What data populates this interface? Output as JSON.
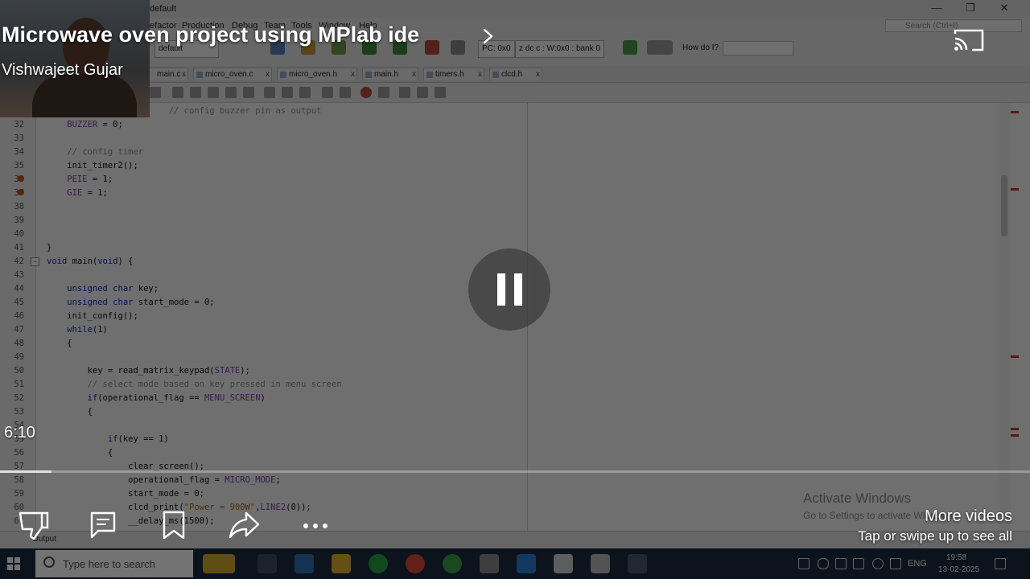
{
  "ide": {
    "title": "default",
    "menu": [
      "efactor",
      "Production",
      "Debug",
      "Team",
      "Tools",
      "Window",
      "Help"
    ],
    "search_placeholder": "Search (Ctrl+I)",
    "config_value": "default",
    "pc": "PC: 0x0",
    "status": "z dc c  : W:0x0 : bank 0",
    "how_do_i": "How do I?",
    "tabs": [
      "main.c",
      "micro_oven.c",
      "micro_oven.h",
      "main.h",
      "timers.h",
      "clcd.h"
    ],
    "output_label": "Output",
    "watermark_title": "Activate Windows",
    "watermark_sub": "Go to Settings to activate Windows."
  },
  "code": [
    {
      "n": "",
      "parts": [
        [
          "",
          "        0;              "
        ],
        [
          "cm",
          "// config buzzer pin as output"
        ]
      ]
    },
    {
      "n": "32",
      "parts": [
        [
          "mc",
          "    BUZZER"
        ],
        [
          "",
          " = 0;"
        ]
      ]
    },
    {
      "n": "33",
      "parts": []
    },
    {
      "n": "34",
      "parts": [
        [
          "cm",
          "    // config timer"
        ]
      ]
    },
    {
      "n": "35",
      "parts": [
        [
          "",
          "    init_timer2();"
        ]
      ]
    },
    {
      "n": "36",
      "parts": [
        [
          "mc",
          "    PEIE"
        ],
        [
          "",
          " = 1;"
        ]
      ]
    },
    {
      "n": "37",
      "parts": [
        [
          "mc",
          "    GIE"
        ],
        [
          "",
          " = 1;"
        ]
      ]
    },
    {
      "n": "38",
      "parts": []
    },
    {
      "n": "39",
      "parts": []
    },
    {
      "n": "40",
      "parts": []
    },
    {
      "n": "41",
      "parts": [
        [
          "",
          "}"
        ]
      ]
    },
    {
      "n": "42",
      "parts": [
        [
          "kw",
          "void"
        ],
        [
          "",
          " main("
        ],
        [
          "kw",
          "void"
        ],
        [
          "",
          ") {"
        ]
      ]
    },
    {
      "n": "43",
      "parts": []
    },
    {
      "n": "44",
      "parts": [
        [
          "kw",
          "    unsigned char"
        ],
        [
          "",
          " key;"
        ]
      ]
    },
    {
      "n": "45",
      "parts": [
        [
          "kw",
          "    unsigned char"
        ],
        [
          "",
          " start_mode = 0;"
        ]
      ]
    },
    {
      "n": "46",
      "parts": [
        [
          "",
          "    init_config();"
        ]
      ]
    },
    {
      "n": "47",
      "parts": [
        [
          "kw",
          "    while"
        ],
        [
          "",
          "(1)"
        ]
      ]
    },
    {
      "n": "48",
      "parts": [
        [
          "",
          "    {"
        ]
      ]
    },
    {
      "n": "49",
      "parts": []
    },
    {
      "n": "50",
      "parts": [
        [
          "",
          "        key = read_matrix_keypad("
        ],
        [
          "mc",
          "STATE"
        ],
        [
          "",
          ");"
        ]
      ]
    },
    {
      "n": "51",
      "parts": [
        [
          "cm",
          "        // select mode based on key pressed in menu screen"
        ]
      ]
    },
    {
      "n": "52",
      "parts": [
        [
          "kw",
          "        if"
        ],
        [
          "",
          "(operational_flag == "
        ],
        [
          "mc",
          "MENU_SCREEN"
        ],
        [
          "",
          ")"
        ]
      ]
    },
    {
      "n": "53",
      "parts": [
        [
          "",
          "        {"
        ]
      ]
    },
    {
      "n": "54",
      "parts": []
    },
    {
      "n": "55",
      "parts": [
        [
          "kw",
          "            if"
        ],
        [
          "",
          "(key == 1)"
        ]
      ]
    },
    {
      "n": "56",
      "parts": [
        [
          "",
          "            {"
        ]
      ]
    },
    {
      "n": "57",
      "parts": [
        [
          "",
          "                clear_screen();"
        ]
      ]
    },
    {
      "n": "58",
      "parts": [
        [
          "",
          "                operational_flag = "
        ],
        [
          "mc",
          "MICRO_MODE"
        ],
        [
          "",
          ";"
        ]
      ]
    },
    {
      "n": "59",
      "parts": [
        [
          "",
          "                start_mode = 0;"
        ]
      ]
    },
    {
      "n": "60",
      "parts": [
        [
          "",
          "                clcd_print("
        ],
        [
          "str",
          "\"Power = 900W\""
        ],
        [
          "",
          ","
        ],
        [
          "mc",
          "LINE2"
        ],
        [
          "",
          "(0));"
        ]
      ]
    },
    {
      "n": "61",
      "parts": [
        [
          "",
          "                __delay_ms(1500);"
        ]
      ]
    }
  ],
  "taskbar": {
    "search_placeholder": "Type here to search",
    "lang": "ENG",
    "time": "19:58",
    "date": "13-02-2025"
  },
  "player": {
    "title": "Microwave oven project using MPlab ide",
    "channel": "Vishwajeet Gujar",
    "elapsed": "6:10",
    "progress": 0.05,
    "more_videos": "More videos",
    "more_videos_hint": "Tap or swipe up to see all"
  },
  "icons": {
    "cast": "cast-icon",
    "pause": "pause-icon",
    "dislike": "dislike-icon",
    "comment": "comment-icon",
    "save": "bookmark-icon",
    "share": "share-icon",
    "more": "more-horizontal-icon",
    "chevron": "chevron-right-icon"
  }
}
